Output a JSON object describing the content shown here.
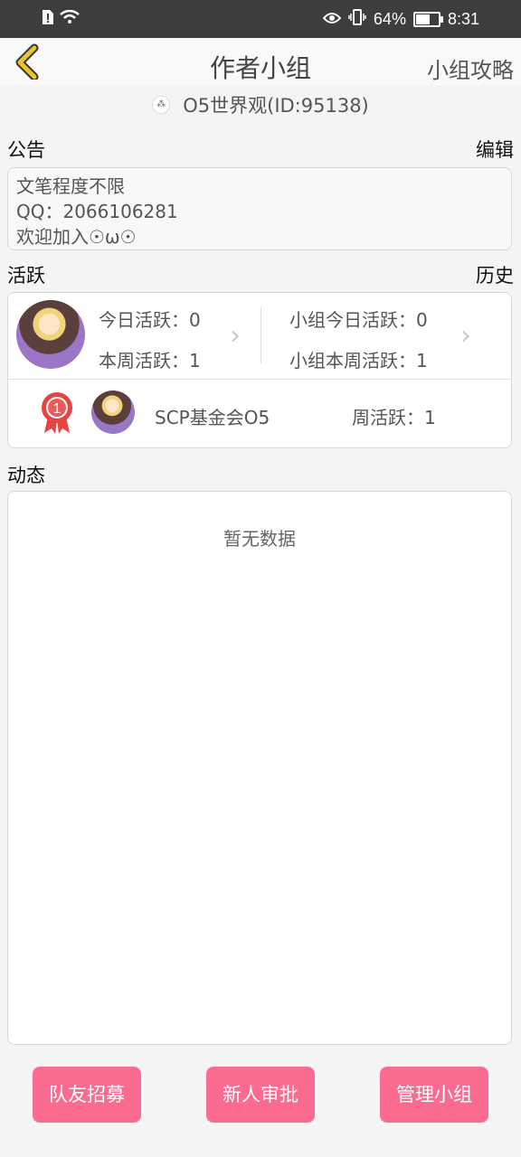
{
  "statusbar": {
    "battery": "64%",
    "time": "8:31",
    "battery_level": 0.64
  },
  "header": {
    "title": "作者小组",
    "guide": "小组攻略"
  },
  "group": {
    "name": "O5世界观(ID:95138)"
  },
  "notice": {
    "title": "公告",
    "edit_label": "编辑",
    "lines": [
      "文笔程度不限",
      "QQ：2066106281",
      "欢迎加入☉ω☉"
    ]
  },
  "activity": {
    "title": "活跃",
    "history_label": "历史",
    "today": "今日活跃：0",
    "week": "本周活跃：1",
    "group_today": "小组今日活跃：0",
    "group_week": "小组本周活跃：1",
    "ranking": [
      {
        "rank": "1",
        "name": "SCP基金会O5",
        "weekly": "周活跃：1"
      }
    ]
  },
  "feed": {
    "title": "动态",
    "empty_text": "暂无数据"
  },
  "buttons": {
    "recruit": "队友招募",
    "approve": "新人审批",
    "manage": "管理小组"
  },
  "colors": {
    "accent": "#fb6a8f",
    "back_arrow": "#e8c52d",
    "medal": "#e84343"
  }
}
